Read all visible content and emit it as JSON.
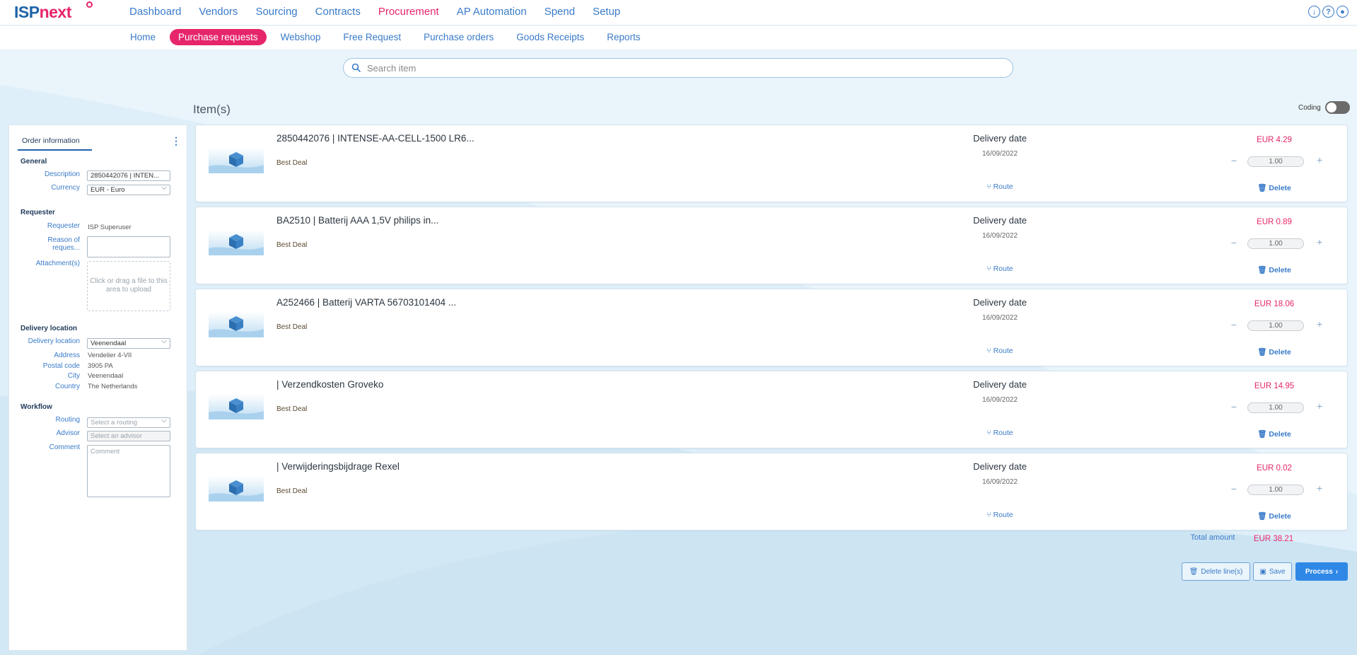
{
  "app": {
    "logo": {
      "part1": "ISP",
      "part2": "next"
    },
    "main_nav": [
      "Dashboard",
      "Vendors",
      "Sourcing",
      "Contracts",
      "Procurement",
      "AP Automation",
      "Spend",
      "Setup"
    ],
    "main_nav_active": "Procurement",
    "top_icons": [
      "download-icon",
      "help-icon",
      "user-icon"
    ],
    "sub_nav": [
      "Home",
      "Purchase requests",
      "Webshop",
      "Free Request",
      "Purchase orders",
      "Goods Receipts",
      "Reports"
    ],
    "sub_nav_active": "Purchase requests"
  },
  "search": {
    "placeholder": "Search item"
  },
  "items_heading": "Item(s)",
  "coding_label": "Coding",
  "order_info": {
    "tab": "Order information",
    "general": {
      "title": "General",
      "description_label": "Description",
      "description_value": "2850442076 | INTEN...",
      "currency_label": "Currency",
      "currency_value": "EUR - Euro"
    },
    "requester": {
      "title": "Requester",
      "requester_label": "Requester",
      "requester_value": "ISP Superuser",
      "reason_label": "Reason of reques...",
      "attachments_label": "Attachment(s)",
      "upload_text": "Click or drag a file to this area to upload"
    },
    "delivery": {
      "title": "Delivery location",
      "location_label": "Delivery location",
      "location_value": "Veenendaal",
      "address_label": "Address",
      "address_value": "Vendelier 4-VII",
      "postal_label": "Postal code",
      "postal_value": "3905 PA",
      "city_label": "City",
      "city_value": "Veenendaal",
      "country_label": "Country",
      "country_value": "The Netherlands"
    },
    "workflow": {
      "title": "Workflow",
      "routing_label": "Routing",
      "routing_placeholder": "Select a routing",
      "advisor_label": "Advisor",
      "advisor_placeholder": "Select an advisor",
      "comment_label": "Comment",
      "comment_placeholder": "Comment"
    }
  },
  "items": [
    {
      "title": "2850442076 | INTENSE-AA-CELL-1500 LR6...",
      "deal": "Best Deal",
      "delivery_label": "Delivery date",
      "delivery_date": "16/09/2022",
      "route": "Route",
      "price": "EUR 4.29",
      "qty": "1.00",
      "delete": "Delete"
    },
    {
      "title": "BA2510 | Batterij AAA 1,5V philips in...",
      "deal": "Best Deal",
      "delivery_label": "Delivery date",
      "delivery_date": "16/09/2022",
      "route": "Route",
      "price": "EUR 0.89",
      "qty": "1.00",
      "delete": "Delete"
    },
    {
      "title": "A252466 | Batterij VARTA 56703101404 ...",
      "deal": "Best Deal",
      "delivery_label": "Delivery date",
      "delivery_date": "16/09/2022",
      "route": "Route",
      "price": "EUR 18.06",
      "qty": "1.00",
      "delete": "Delete"
    },
    {
      "title": "| Verzendkosten Groveko",
      "deal": "Best Deal",
      "delivery_label": "Delivery date",
      "delivery_date": "16/09/2022",
      "route": "Route",
      "price": "EUR 14.95",
      "qty": "1.00",
      "delete": "Delete"
    },
    {
      "title": "| Verwijderingsbijdrage Rexel",
      "deal": "Best Deal",
      "delivery_label": "Delivery date",
      "delivery_date": "16/09/2022",
      "route": "Route",
      "price": "EUR 0.02",
      "qty": "1.00",
      "delete": "Delete"
    }
  ],
  "total": {
    "label": "Total amount",
    "value": "EUR 38.21"
  },
  "actions": {
    "delete_lines": "Delete line(s)",
    "save": "Save",
    "process": "Process"
  },
  "colors": {
    "brand_blue": "#1e63a8",
    "brand_pink": "#e6256b",
    "link_blue": "#3a7bc8",
    "primary_button": "#2f88e6"
  }
}
